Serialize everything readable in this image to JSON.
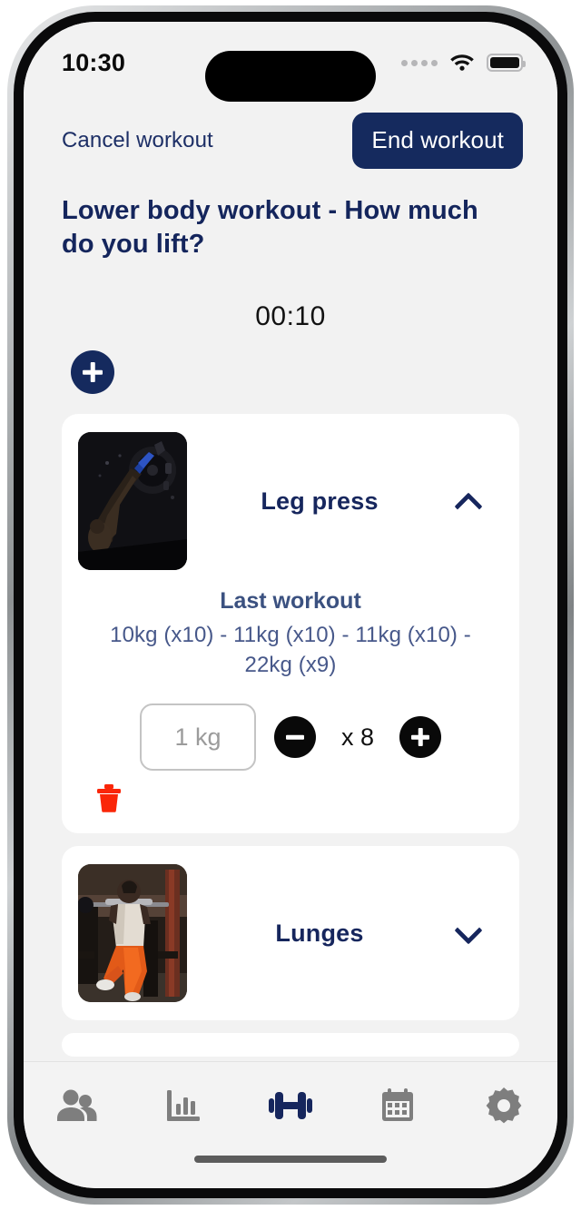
{
  "status_bar": {
    "time": "10:30",
    "signal_icon": "cellular-dots-icon",
    "wifi_icon": "wifi-icon",
    "battery_icon": "battery-full-icon"
  },
  "header": {
    "cancel_label": "Cancel workout",
    "end_label": "End workout",
    "title": "Lower body workout - How much do you lift?"
  },
  "timer": {
    "value": "00:10"
  },
  "add_exercise": {
    "icon": "plus-icon"
  },
  "exercises": [
    {
      "name": "Leg press",
      "expanded": true,
      "chevron_icon": "chevron-up-icon",
      "thumbnail": "leg-press-photo",
      "last_workout_label": "Last workout",
      "last_workout_sets": "10kg (x10)  - 11kg (x10)  - 11kg (x10)  - 22kg (x9)",
      "weight_value": "",
      "weight_placeholder": "1 kg",
      "decrement_icon": "minus-icon",
      "reps_label": "x 8",
      "increment_icon": "plus-icon",
      "delete_icon": "trash-icon"
    },
    {
      "name": "Lunges",
      "expanded": false,
      "chevron_icon": "chevron-down-icon",
      "thumbnail": "lunges-photo"
    }
  ],
  "tabbar": {
    "items": [
      {
        "icon": "people-icon",
        "active": false
      },
      {
        "icon": "chart-icon",
        "active": false
      },
      {
        "icon": "dumbbell-icon",
        "active": true
      },
      {
        "icon": "calendar-icon",
        "active": false
      },
      {
        "icon": "gear-icon",
        "active": false
      }
    ]
  },
  "colors": {
    "brand_navy": "#152a5e",
    "title_navy": "#14255c",
    "muted_blue": "#47588a",
    "delete_red": "#fa2608",
    "page_bg": "#f2f2f2",
    "card_bg": "#ffffff",
    "tab_inactive": "#7e7e7e"
  }
}
